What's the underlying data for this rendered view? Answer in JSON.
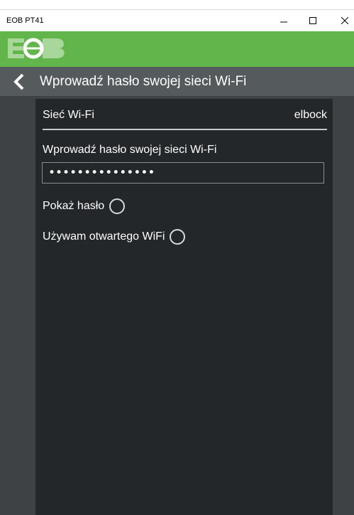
{
  "window": {
    "title": "EOB PT41",
    "minimize_icon": "minimize-icon",
    "maximize_icon": "maximize-icon",
    "close_icon": "close-icon"
  },
  "brand": {
    "logo_icon": "eob-logo",
    "color": "#62b54a"
  },
  "header": {
    "back_icon": "chevron-left-icon",
    "title": "Wprowadź hasło swojej sieci Wi-Fi"
  },
  "form": {
    "network_label": "Sieć Wi-Fi",
    "network_value": "elbock",
    "password_label": "Wprowadź hasło swojej sieci Wi-Fi",
    "password_value": "•••••••••••••••",
    "show_password_label": "Pokaż hasło",
    "open_wifi_label": "Używam otwartego WiFi"
  },
  "colors": {
    "header_bg": "#555a5c",
    "panel_bg": "#242729",
    "content_bg": "#3f4244"
  }
}
